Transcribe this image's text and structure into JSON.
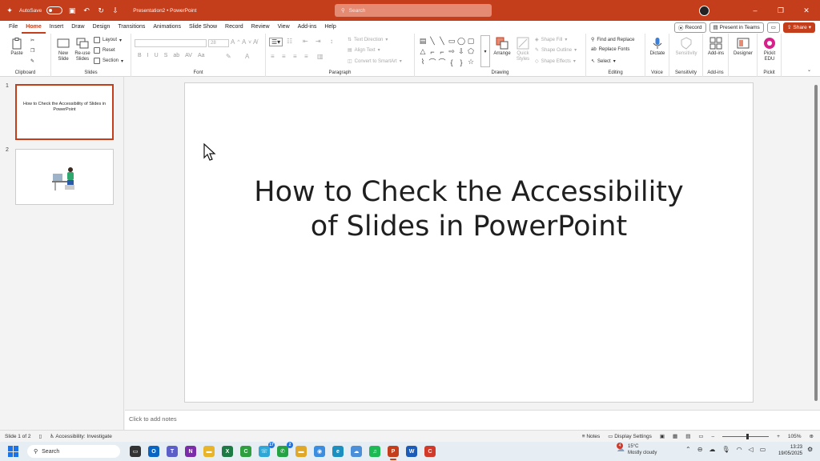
{
  "titlebar": {
    "autosave_label": "AutoSave",
    "doc_title": "Presentation2 • PowerPoint",
    "search_placeholder": "Search"
  },
  "menu": {
    "tabs": [
      "File",
      "Home",
      "Insert",
      "Draw",
      "Design",
      "Transitions",
      "Animations",
      "Slide Show",
      "Record",
      "Review",
      "View",
      "Add-ins",
      "Help"
    ],
    "active_tab": "Home",
    "record_label": "Record",
    "present_label": "Present in Teams",
    "share_label": "Share"
  },
  "ribbon": {
    "clipboard": {
      "paste": "Paste",
      "label": "Clipboard"
    },
    "slides": {
      "new_slide": "New Slide",
      "reuse": "Re-use Slides",
      "layout": "Layout",
      "reset": "Reset",
      "section": "Section",
      "label": "Slides"
    },
    "font": {
      "size_value": "28",
      "label": "Font",
      "format_buttons": [
        "B",
        "I",
        "U",
        "S",
        "ab",
        "AV",
        "Aa"
      ]
    },
    "paragraph": {
      "text_direction": "Text Direction",
      "align_text": "Align Text",
      "convert": "Convert to SmartArt",
      "label": "Paragraph"
    },
    "drawing": {
      "arrange": "Arrange",
      "quick_styles": "Quick Styles",
      "shape_fill": "Shape Fill",
      "shape_outline": "Shape Outline",
      "shape_effects": "Shape Effects",
      "label": "Drawing"
    },
    "editing": {
      "find_replace": "Find and Replace",
      "replace_fonts": "Replace Fonts",
      "select": "Select",
      "label": "Editing"
    },
    "voice": {
      "dictate": "Dictate",
      "label": "Voice"
    },
    "sensitivity": {
      "button": "Sensitivity",
      "label": "Sensitivity"
    },
    "addins": {
      "button": "Add-ins",
      "label": "Add-ins"
    },
    "designer": {
      "button": "Designer"
    },
    "pickit": {
      "button": "Pickit EDU",
      "label": "Pickit"
    }
  },
  "thumbnails": [
    {
      "number": "1",
      "text": "How to Check the Accessibility of Slides in PowerPoint"
    },
    {
      "number": "2",
      "text": ""
    }
  ],
  "slide": {
    "title_line1": "How to Check the Accessibility",
    "title_line2": "of Slides in PowerPoint"
  },
  "notes": {
    "placeholder": "Click to add notes"
  },
  "status": {
    "slide_counter": "Slide 1 of 2",
    "accessibility": "Accessibility: Investigate",
    "notes_label": "Notes",
    "display_settings": "Display Settings",
    "zoom": "105%"
  },
  "taskbar": {
    "search_placeholder": "Search",
    "apps": [
      {
        "name": "task-view",
        "color": "#333333",
        "glyph": "▭",
        "badge": ""
      },
      {
        "name": "outlook",
        "color": "#0a64c2",
        "glyph": "O",
        "badge": ""
      },
      {
        "name": "teams",
        "color": "#5b5fc7",
        "glyph": "T",
        "badge": ""
      },
      {
        "name": "onenote",
        "color": "#7b2ca8",
        "glyph": "N",
        "badge": ""
      },
      {
        "name": "file-explorer",
        "color": "#e8b429",
        "glyph": "▬",
        "badge": ""
      },
      {
        "name": "excel",
        "color": "#1e7a44",
        "glyph": "X",
        "badge": ""
      },
      {
        "name": "camtasia",
        "color": "#2e9e3e",
        "glyph": "C",
        "badge": ""
      },
      {
        "name": "phone-link",
        "color": "#2fa7d6",
        "glyph": "☏",
        "badge": "17"
      },
      {
        "name": "whatsapp",
        "color": "#25a244",
        "glyph": "✆",
        "badge": "2"
      },
      {
        "name": "folders",
        "color": "#e0a82a",
        "glyph": "▬",
        "badge": ""
      },
      {
        "name": "chrome",
        "color": "#3b8de0",
        "glyph": "◉",
        "badge": ""
      },
      {
        "name": "edge",
        "color": "#1b8fbf",
        "glyph": "e",
        "badge": ""
      },
      {
        "name": "photos",
        "color": "#4b8fd9",
        "glyph": "☁",
        "badge": ""
      },
      {
        "name": "spotify",
        "color": "#1db954",
        "glyph": "♫",
        "badge": ""
      },
      {
        "name": "powerpoint",
        "color": "#c43e1c",
        "glyph": "P",
        "badge": ""
      },
      {
        "name": "word",
        "color": "#1d5bb8",
        "glyph": "W",
        "badge": ""
      },
      {
        "name": "canva",
        "color": "#d13a2a",
        "glyph": "C",
        "badge": ""
      }
    ],
    "weather_temp": "15°C",
    "weather_desc": "Mostly cloudy",
    "weather_badge": "4",
    "time": "13:23",
    "date": "19/05/2025"
  },
  "colors": {
    "accent": "#c43e1c",
    "taskbar": "#e6eef4"
  }
}
